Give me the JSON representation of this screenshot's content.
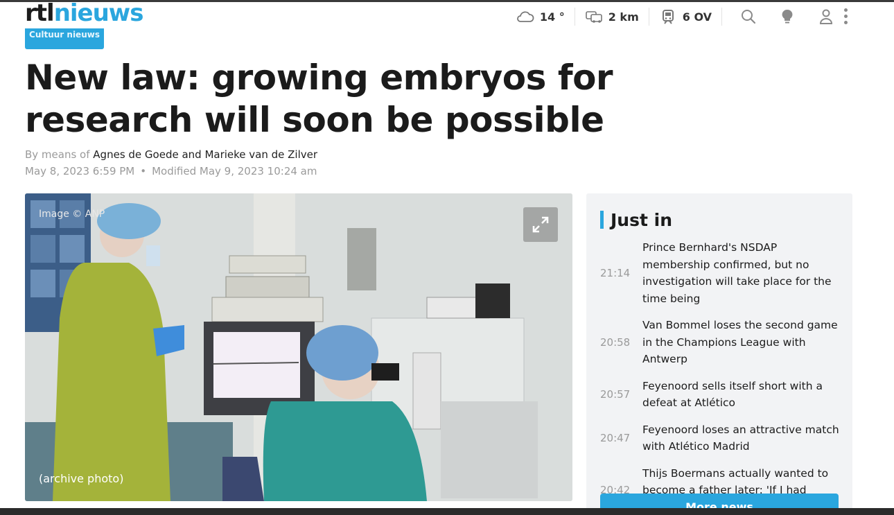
{
  "header": {
    "logo_part1": "rtl",
    "logo_part2": "nieuws",
    "weather": "14 °",
    "traffic": "2 km",
    "transit": "6 OV",
    "icons": [
      "cloud-icon",
      "car-icon",
      "train-icon",
      "search-icon",
      "lightbulb-icon",
      "user-icon",
      "more-vertical-icon"
    ]
  },
  "article": {
    "category": "Cultuur nieuws",
    "title": "New law: growing embryos for research will soon be possible",
    "byline_prefix": "By means of",
    "authors": "Agnes de Goede and Marieke van de Zilver",
    "published": "May 8, 2023 6:59 PM",
    "dot": "•",
    "modified": "Modified May 9, 2023 10:24 am",
    "image_credit": "Image © ANP",
    "image_caption": "(archive photo)"
  },
  "sidebar": {
    "title": "Just in",
    "items": [
      {
        "time": "21:14",
        "text": "Prince Bernhard's NSDAP membership confirmed, but no investigation will take place for the time being"
      },
      {
        "time": "20:58",
        "text": "Van Bommel loses the second game in the Champions League with Antwerp"
      },
      {
        "time": "20:57",
        "text": "Feyenoord sells itself short with a defeat at Atlético"
      },
      {
        "time": "20:47",
        "text": "Feyenoord loses an attractive match with Atlético Madrid"
      },
      {
        "time": "20:42",
        "text": "Thijs Boermans actually wanted to become a father later: 'If I had fooled around enough'"
      }
    ],
    "more_button": "More news"
  },
  "colors": {
    "accent": "#2aa6de",
    "text": "#1b1b1b",
    "muted": "#9a9a9a",
    "sidebar_bg": "#f2f3f5"
  }
}
